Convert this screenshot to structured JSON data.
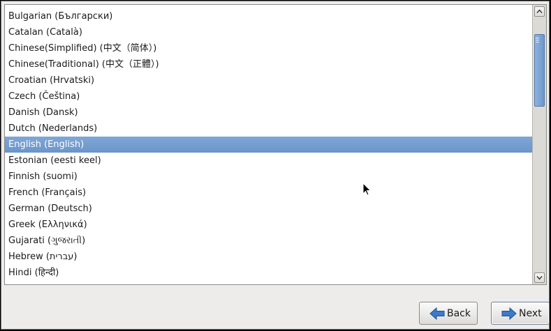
{
  "language_list": {
    "items": [
      {
        "label": "Bulgarian (Български)",
        "selected": false
      },
      {
        "label": "Catalan (Català)",
        "selected": false
      },
      {
        "label": "Chinese(Simplified) (中文（简体）)",
        "selected": false
      },
      {
        "label": "Chinese(Traditional) (中文（正體）)",
        "selected": false
      },
      {
        "label": "Croatian (Hrvatski)",
        "selected": false
      },
      {
        "label": "Czech (Čeština)",
        "selected": false
      },
      {
        "label": "Danish (Dansk)",
        "selected": false
      },
      {
        "label": "Dutch (Nederlands)",
        "selected": false
      },
      {
        "label": "English (English)",
        "selected": true
      },
      {
        "label": "Estonian (eesti keel)",
        "selected": false
      },
      {
        "label": "Finnish (suomi)",
        "selected": false
      },
      {
        "label": "French (Français)",
        "selected": false
      },
      {
        "label": "German (Deutsch)",
        "selected": false
      },
      {
        "label": "Greek (Ελληνικά)",
        "selected": false
      },
      {
        "label": "Gujarati (ગુજરાતી)",
        "selected": false
      },
      {
        "label": "Hebrew (עברית)",
        "selected": false
      },
      {
        "label": "Hindi (हिन्दी)",
        "selected": false
      }
    ]
  },
  "buttons": {
    "back_label": "Back",
    "next_label": "Next"
  },
  "icons": {
    "scroll_up": "chevron-up-icon",
    "scroll_down": "chevron-down-icon",
    "back": "arrow-left-icon",
    "next": "arrow-right-icon"
  },
  "colors": {
    "selection": "#6b95c9",
    "arrow_blue": "#2f6fbf"
  }
}
